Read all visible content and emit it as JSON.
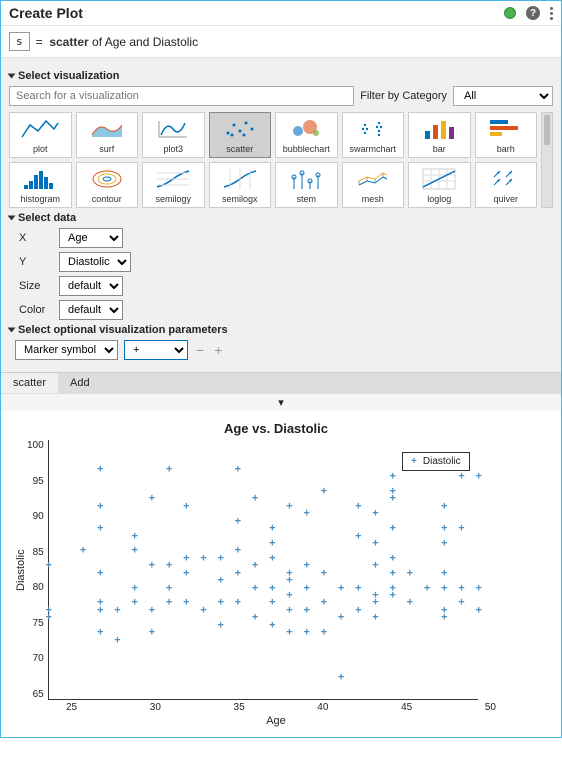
{
  "header": {
    "title": "Create Plot"
  },
  "signature": {
    "var": "s",
    "eq": "=",
    "type": "scatter",
    "of": "of Age and Diastolic"
  },
  "sections": {
    "viz": "Select visualization",
    "data": "Select data",
    "opt": "Select optional visualization parameters"
  },
  "search": {
    "placeholder": "Search for a visualization",
    "filter_label": "Filter by Category",
    "filter_value": "All"
  },
  "viz_items": [
    {
      "label": "plot"
    },
    {
      "label": "surf"
    },
    {
      "label": "plot3"
    },
    {
      "label": "scatter",
      "selected": true
    },
    {
      "label": "bubblechart"
    },
    {
      "label": "swarmchart"
    },
    {
      "label": "bar"
    },
    {
      "label": "barh"
    },
    {
      "label": "histogram"
    },
    {
      "label": "contour"
    },
    {
      "label": "semilogy"
    },
    {
      "label": "semilogx"
    },
    {
      "label": "stem"
    },
    {
      "label": "mesh"
    },
    {
      "label": "loglog"
    },
    {
      "label": "quiver"
    }
  ],
  "data_fields": {
    "x_label": "X",
    "x_value": "Age",
    "y_label": "Y",
    "y_value": "Diastolic",
    "size_label": "Size",
    "size_value": "default",
    "color_label": "Color",
    "color_value": "default"
  },
  "opt_params": {
    "param1": "Marker symbol",
    "param2": "+"
  },
  "tabs": {
    "t1": "scatter",
    "t2": "Add"
  },
  "chart_data": {
    "type": "scatter",
    "title": "Age vs. Diastolic",
    "xlabel": "Age",
    "ylabel": "Diastolic",
    "xlim": [
      25,
      50
    ],
    "ylim": [
      65,
      100
    ],
    "xticks": [
      25,
      30,
      35,
      40,
      45,
      50
    ],
    "yticks": [
      65,
      70,
      75,
      80,
      85,
      90,
      95,
      100
    ],
    "legend": "Diastolic",
    "series": [
      {
        "name": "Diastolic",
        "marker": "+",
        "points": [
          [
            25,
            77
          ],
          [
            25,
            76
          ],
          [
            25,
            83
          ],
          [
            27,
            85
          ],
          [
            28,
            96
          ],
          [
            28,
            78
          ],
          [
            28,
            82
          ],
          [
            28,
            88
          ],
          [
            28,
            91
          ],
          [
            28,
            74
          ],
          [
            28,
            77
          ],
          [
            29,
            77
          ],
          [
            29,
            73
          ],
          [
            30,
            80
          ],
          [
            30,
            87
          ],
          [
            30,
            78
          ],
          [
            30,
            85
          ],
          [
            31,
            77
          ],
          [
            31,
            83
          ],
          [
            31,
            74
          ],
          [
            31,
            92
          ],
          [
            32,
            78
          ],
          [
            32,
            96
          ],
          [
            32,
            80
          ],
          [
            32,
            83
          ],
          [
            33,
            82
          ],
          [
            33,
            78
          ],
          [
            33,
            84
          ],
          [
            33,
            91
          ],
          [
            34,
            77
          ],
          [
            34,
            84
          ],
          [
            35,
            78
          ],
          [
            35,
            75
          ],
          [
            35,
            81
          ],
          [
            35,
            84
          ],
          [
            36,
            85
          ],
          [
            36,
            78
          ],
          [
            36,
            82
          ],
          [
            36,
            89
          ],
          [
            36,
            96
          ],
          [
            37,
            80
          ],
          [
            37,
            76
          ],
          [
            37,
            92
          ],
          [
            37,
            83
          ],
          [
            38,
            78
          ],
          [
            38,
            84
          ],
          [
            38,
            80
          ],
          [
            38,
            88
          ],
          [
            38,
            75
          ],
          [
            38,
            86
          ],
          [
            39,
            77
          ],
          [
            39,
            82
          ],
          [
            39,
            79
          ],
          [
            39,
            91
          ],
          [
            39,
            74
          ],
          [
            39,
            81
          ],
          [
            40,
            80
          ],
          [
            40,
            83
          ],
          [
            40,
            77
          ],
          [
            40,
            90
          ],
          [
            40,
            74
          ],
          [
            41,
            78
          ],
          [
            41,
            82
          ],
          [
            41,
            74
          ],
          [
            41,
            93
          ],
          [
            42,
            80
          ],
          [
            42,
            76
          ],
          [
            42,
            68
          ],
          [
            43,
            80
          ],
          [
            43,
            91
          ],
          [
            43,
            77
          ],
          [
            43,
            87
          ],
          [
            44,
            79
          ],
          [
            44,
            83
          ],
          [
            44,
            86
          ],
          [
            44,
            90
          ],
          [
            44,
            78
          ],
          [
            44,
            76
          ],
          [
            45,
            80
          ],
          [
            45,
            92
          ],
          [
            45,
            84
          ],
          [
            45,
            88
          ],
          [
            45,
            93
          ],
          [
            45,
            95
          ],
          [
            45,
            79
          ],
          [
            45,
            82
          ],
          [
            46,
            78
          ],
          [
            46,
            82
          ],
          [
            47,
            80
          ],
          [
            48,
            77
          ],
          [
            48,
            80
          ],
          [
            48,
            88
          ],
          [
            48,
            86
          ],
          [
            48,
            82
          ],
          [
            48,
            91
          ],
          [
            48,
            76
          ],
          [
            49,
            80
          ],
          [
            49,
            88
          ],
          [
            49,
            95
          ],
          [
            49,
            78
          ],
          [
            50,
            95
          ],
          [
            50,
            77
          ],
          [
            50,
            80
          ]
        ]
      }
    ]
  }
}
